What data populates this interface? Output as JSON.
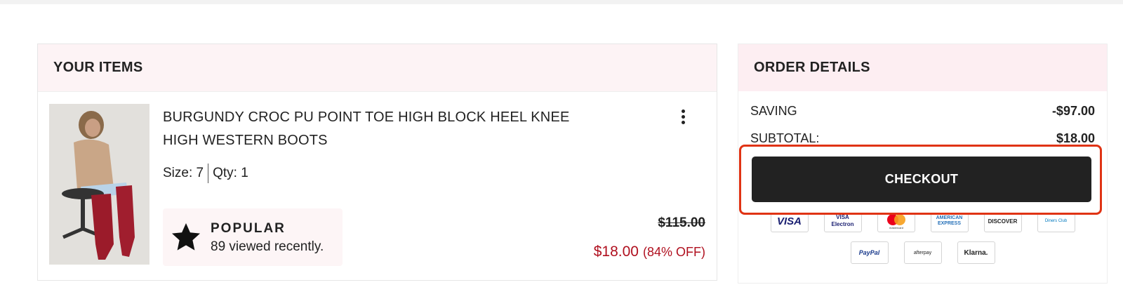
{
  "cart": {
    "header": "YOUR ITEMS",
    "item": {
      "title": "BURGUNDY CROC PU POINT TOE HIGH BLOCK HEEL KNEE HIGH WESTERN BOOTS",
      "size": "Size: 7",
      "qty": "Qty: 1",
      "popular_label": "POPULAR",
      "popular_text": "89 viewed recently.",
      "original_price": "$115.00",
      "sale_price": "$18.00",
      "discount": "(84% OFF)"
    }
  },
  "order": {
    "header": "ORDER DETAILS",
    "saving_label": "SAVING",
    "saving_value": "-$97.00",
    "subtotal_label": "SUBTOTAL:",
    "subtotal_value": "$18.00",
    "checkout_label": "CHECKOUT",
    "payment_methods": [
      "VISA",
      "VISA Electron",
      "mastercard",
      "AMERICAN EXPRESS",
      "DISCOVER",
      "Diners Club",
      "PayPal",
      "afterpay",
      "Klarna."
    ]
  },
  "colors": {
    "accent_red": "#b0101f",
    "highlight_border": "#e03314",
    "checkout_bg": "#222222",
    "header_bg": "#fdf3f5"
  }
}
